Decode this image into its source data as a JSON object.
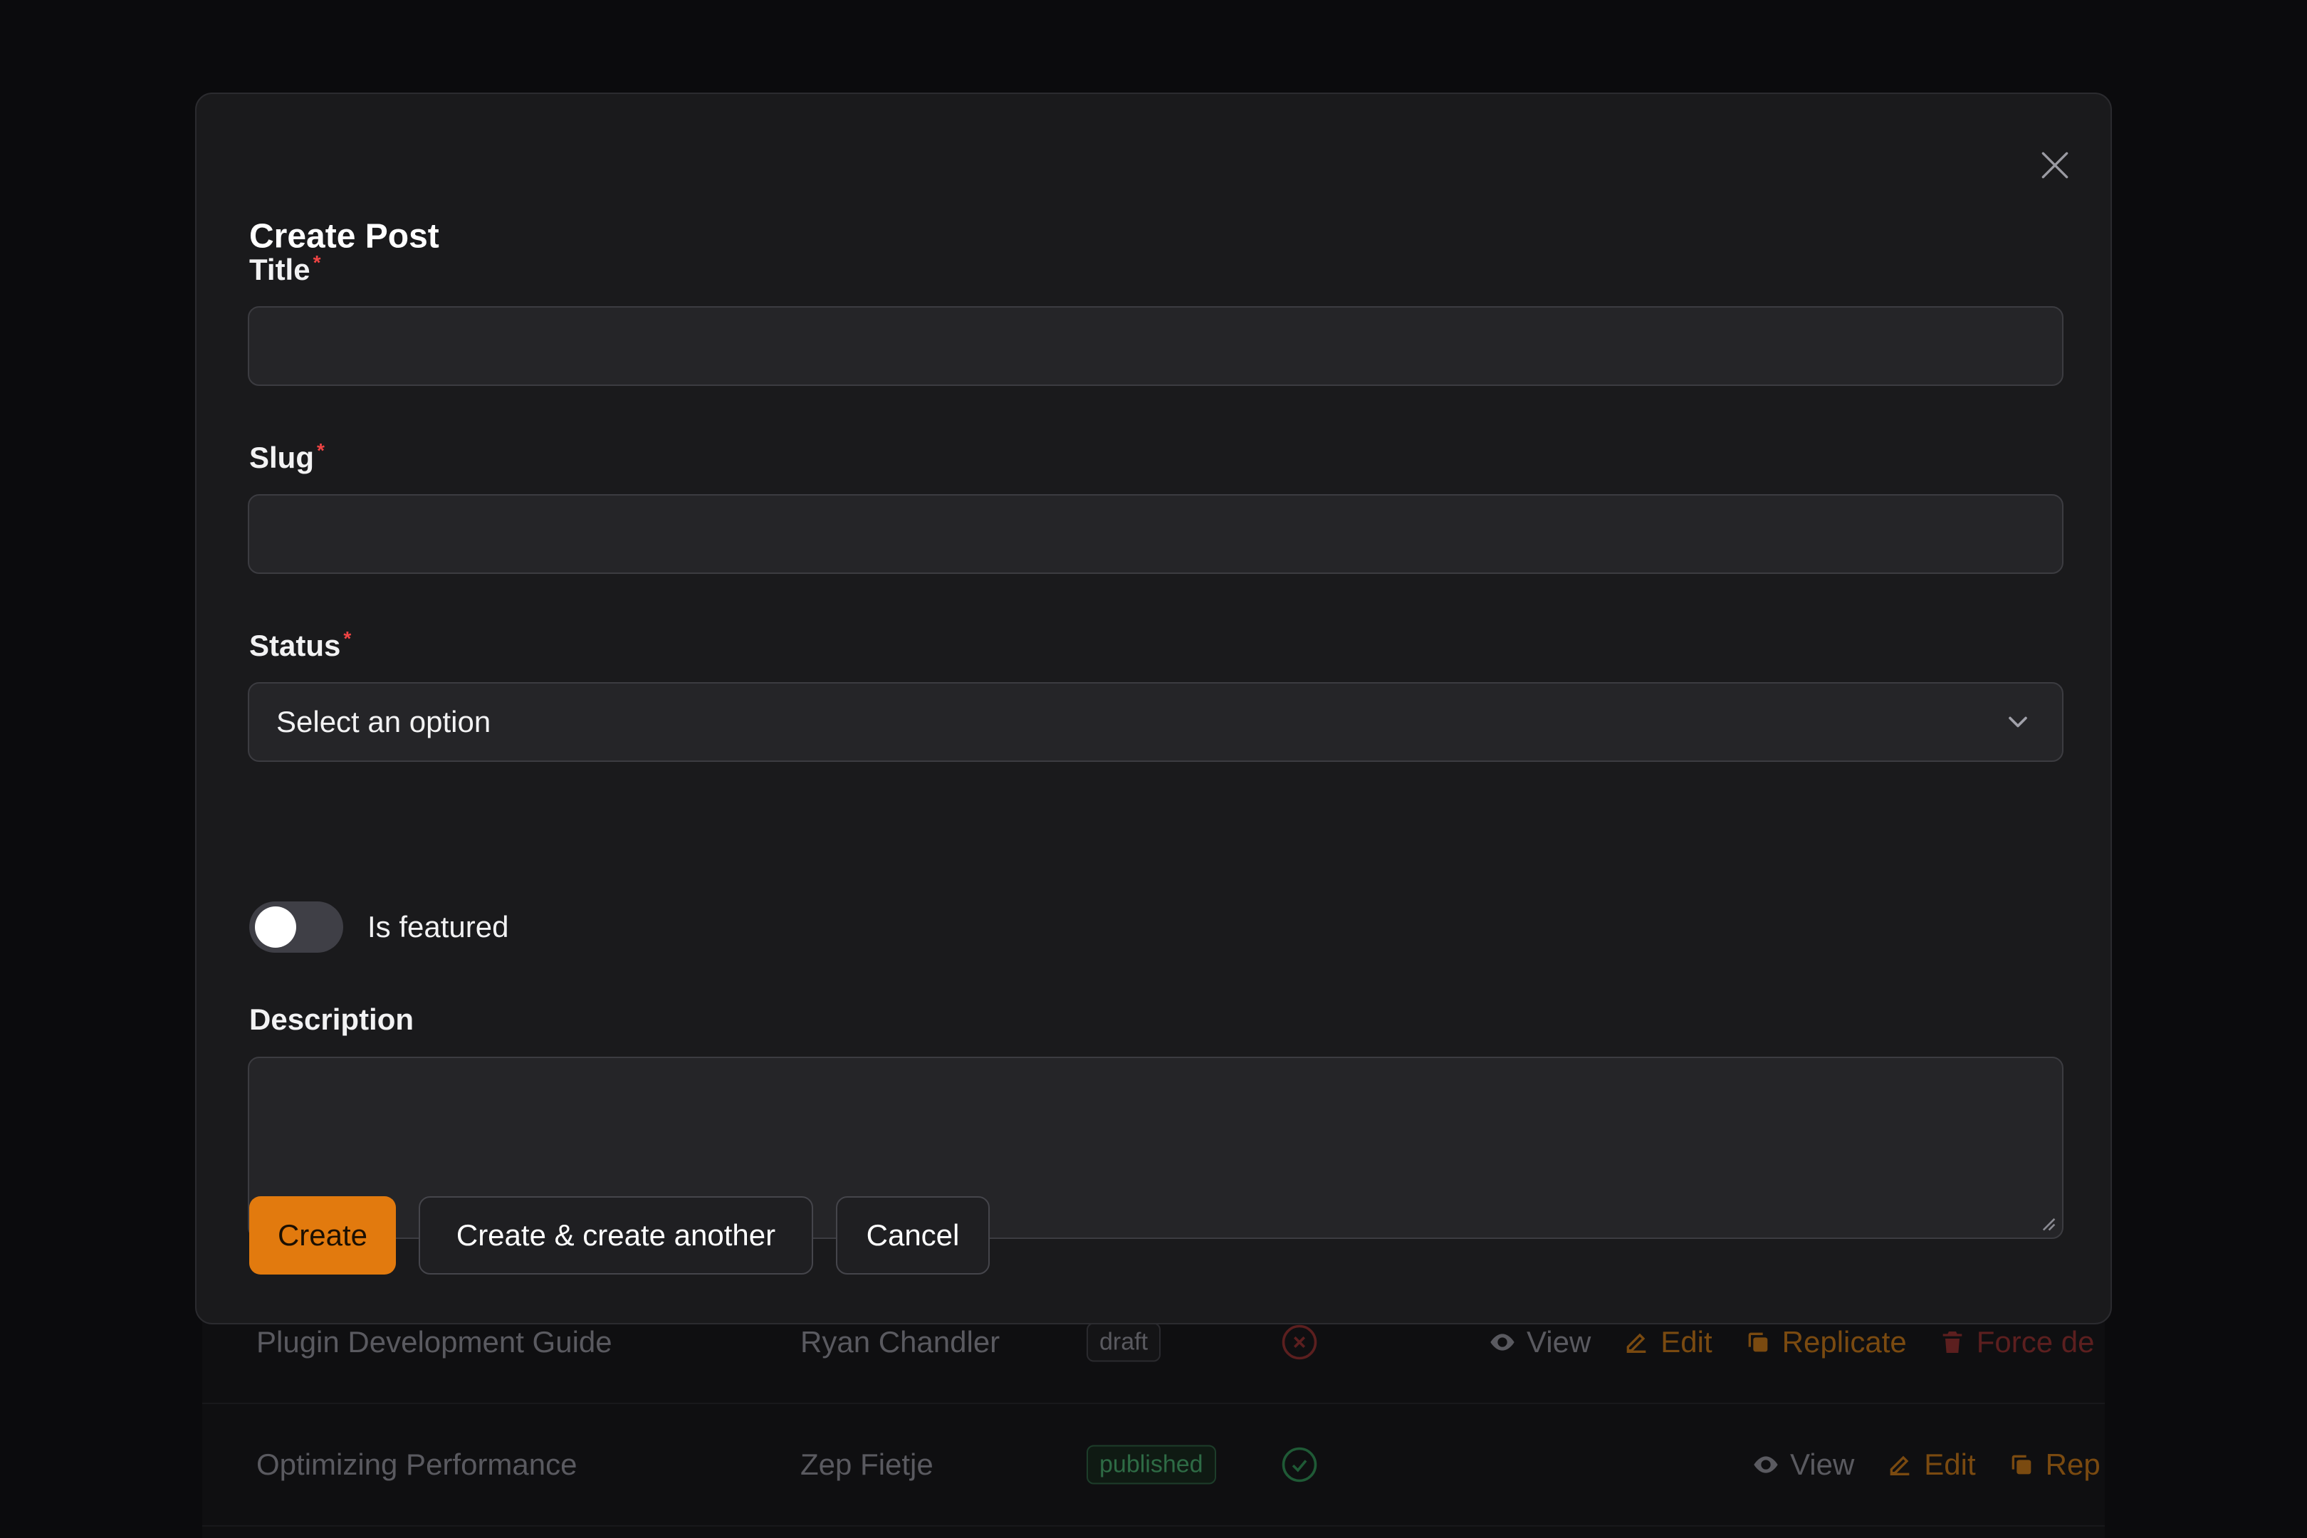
{
  "background_table": {
    "rows": [
      {
        "title": "Plugin Development Guide",
        "author": "Ryan Chandler",
        "status_badge": "draft",
        "status_icon": "x-circle-icon",
        "actions": [
          "View",
          "Edit",
          "Replicate",
          "Force de"
        ]
      },
      {
        "title": "Optimizing Performance",
        "author": "Zep Fietje",
        "status_badge": "published",
        "status_icon": "check-circle-icon",
        "actions": [
          "View",
          "Edit",
          "Rep"
        ]
      }
    ]
  },
  "modal": {
    "title": "Create Post",
    "fields": {
      "title": {
        "label": "Title",
        "required_mark": "*",
        "value": ""
      },
      "slug": {
        "label": "Slug",
        "required_mark": "*",
        "value": ""
      },
      "status": {
        "label": "Status",
        "required_mark": "*",
        "selected": "Select an option"
      },
      "is_featured": {
        "label": "Is featured",
        "checked": false
      },
      "description": {
        "label": "Description",
        "value": ""
      }
    },
    "buttons": {
      "create": "Create",
      "create_another": "Create & create another",
      "cancel": "Cancel"
    }
  },
  "colors": {
    "accent": "#e27a0e",
    "danger": "#ef4444",
    "modal_bg": "#1a1a1c",
    "field_bg": "#252528"
  }
}
